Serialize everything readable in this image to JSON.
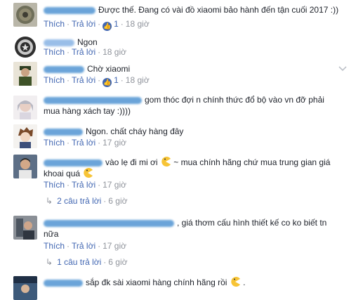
{
  "comments": [
    {
      "text": "Được thế. Đang có vài đồ xiaomi bảo hành đến tận cuối 2017 :))",
      "actions": {
        "like": "Thích",
        "reply": "Trả lời",
        "likes": "1",
        "time": "18 giờ"
      }
    },
    {
      "text": "Ngon",
      "actions": {
        "like": "Thích",
        "reply": "Trả lời",
        "time": "18 giờ"
      }
    },
    {
      "text": "Chờ xiaomi",
      "actions": {
        "like": "Thích",
        "reply": "Trả lời",
        "likes": "1",
        "time": "18 giờ"
      }
    },
    {
      "text_line1": "gom thóc đợi n chính thức đổ bộ vào vn đỡ phải",
      "text_line2": "mua hàng xách tay :))))",
      "actions": {
        "like": "Thích",
        "reply": "Trả lời",
        "time": "18 giờ"
      }
    },
    {
      "text": "Ngon. chất cháy hàng đây",
      "actions": {
        "like": "Thích",
        "reply": "Trả lời",
        "time": "17 giờ"
      }
    },
    {
      "text_a": "vào lẹ đi mi ơi",
      "text_b": "~ mua chính hãng chứ mua trung gian giá",
      "text_line2": "khoai quá",
      "actions": {
        "like": "Thích",
        "reply": "Trả lời",
        "time": "17 giờ"
      },
      "replies": {
        "label": "2 câu trả lời",
        "time": "6 giờ"
      }
    },
    {
      "text_line1": ", giá thơm cấu hình thiết kế co ko biết tn",
      "text_line2": "nữa",
      "actions": {
        "like": "Thích",
        "reply": "Trả lời",
        "time": "17 giờ"
      },
      "replies": {
        "label": "1 câu trả lời",
        "time": "6 giờ"
      }
    },
    {
      "text": "sắp đk sài xiaomi hàng chính hãng rồi",
      "text_end": "."
    }
  ]
}
